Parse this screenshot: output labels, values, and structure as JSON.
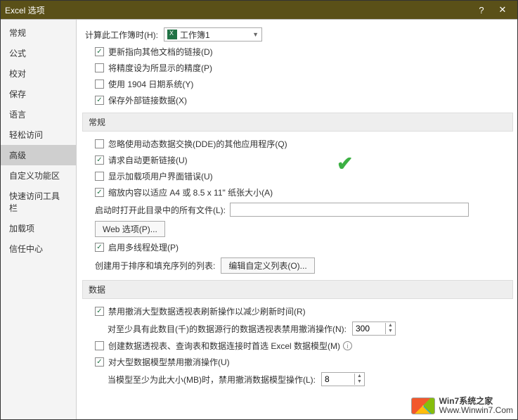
{
  "title": "Excel 选项",
  "sidebar": {
    "items": [
      {
        "label": "常规"
      },
      {
        "label": "公式"
      },
      {
        "label": "校对"
      },
      {
        "label": "保存"
      },
      {
        "label": "语言"
      },
      {
        "label": "轻松访问"
      },
      {
        "label": "高级"
      },
      {
        "label": "自定义功能区"
      },
      {
        "label": "快速访问工具栏"
      },
      {
        "label": "加载项"
      },
      {
        "label": "信任中心"
      }
    ],
    "selected": 6
  },
  "calc_section": {
    "label": "计算此工作簿时(H):",
    "workbook": "工作簿1",
    "opts": [
      {
        "label": "更新指向其他文档的链接(D)",
        "on": true
      },
      {
        "label": "将精度设为所显示的精度(P)",
        "on": false
      },
      {
        "label": "使用 1904 日期系统(Y)",
        "on": false
      },
      {
        "label": "保存外部链接数据(X)",
        "on": true
      }
    ]
  },
  "general_section": {
    "head": "常规",
    "opts": [
      {
        "label": "忽略使用动态数据交换(DDE)的其他应用程序(Q)",
        "on": false
      },
      {
        "label": "请求自动更新链接(U)",
        "on": true
      },
      {
        "label": "显示加载项用户界面错误(U)",
        "on": false
      },
      {
        "label": "缩放内容以适应 A4 或 8.5 x 11\" 纸张大小(A)",
        "on": true
      }
    ],
    "startup_label": "启动时打开此目录中的所有文件(L):",
    "startup_value": "",
    "web_btn": "Web 选项(P)...",
    "multithread": {
      "label": "启用多线程处理(P)",
      "on": true
    },
    "editlist_label": "创建用于排序和填充序列的列表:",
    "editlist_btn": "编辑自定义列表(O)..."
  },
  "data_section": {
    "head": "数据",
    "opt1": {
      "label": "禁用撤消大型数据透视表刷新操作以减少刷新时间(R)",
      "on": true
    },
    "thresh1_label": "对至少具有此数目(千)的数据源行的数据透视表禁用撤消操作(N):",
    "thresh1_value": "300",
    "opt2": {
      "label": "创建数据透视表、查询表和数据连接时首选 Excel 数据模型(M)",
      "on": false
    },
    "opt3": {
      "label": "对大型数据模型禁用撤消操作(U)",
      "on": true
    },
    "thresh2_label": "当模型至少为此大小(MB)时，禁用撤消数据模型操作(L):",
    "thresh2_value": "8"
  },
  "watermark": {
    "line1": "Win7系统之家",
    "line2": "Www.Winwin7.Com"
  }
}
